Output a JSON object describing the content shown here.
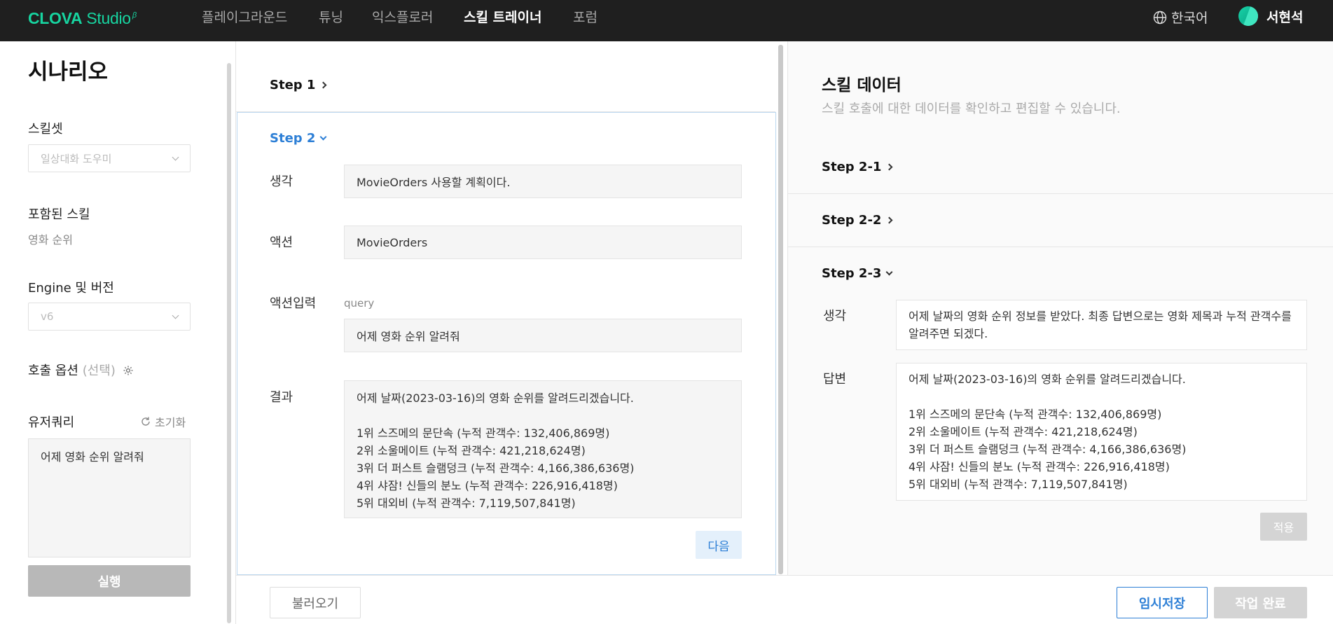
{
  "brand": {
    "name_bold": "CLOVA",
    "name_rest": " Studio",
    "beta": "β"
  },
  "nav": {
    "items": [
      "플레이그라운드",
      "튜닝",
      "익스플로러",
      "스킬 트레이너",
      "포럼"
    ],
    "language": "한국어",
    "user": "서현석"
  },
  "sidebar": {
    "title": "시나리오",
    "skillset_label": "스킬셋",
    "skillset_value": "일상대화 도우미",
    "included_label": "포함된 스킬",
    "included_value": "영화 순위",
    "engine_label": "Engine 및 버전",
    "engine_value": "v6",
    "call_option_label": "호출 옵션",
    "call_option_muted": "(선택)",
    "user_query_label": "유저쿼리",
    "reset_label": "초기화",
    "user_query_value": "어제 영화 순위 알려줘",
    "run_label": "실행"
  },
  "middle": {
    "step1": "Step 1",
    "step2": "Step 2",
    "thought_label": "생각",
    "thought_value": "MovieOrders 사용할 계획이다.",
    "action_label": "액션",
    "action_value": "MovieOrders",
    "action_input_label": "액션입력",
    "action_input_key": "query",
    "action_input_value": "어제 영화 순위 알려줘",
    "result_label": "결과",
    "result_value": "어제 날짜(2023-03-16)의 영화 순위를 알려드리겠습니다.\n\n1위 스즈메의 문단속 (누적 관객수: 132,406,869명)\n2위 소울메이트 (누적 관객수: 421,218,624명)\n3위 더 퍼스트 슬램덩크 (누적 관객수: 4,166,386,636명)\n4위 샤잠! 신들의 분노 (누적 관객수: 226,916,418명)\n5위 대외비 (누적 관객수: 7,119,507,841명)",
    "next_label": "다음"
  },
  "right": {
    "title": "스킬 데이터",
    "subtitle": "스킬 호출에 대한 데이터를 확인하고 편집할 수 있습니다.",
    "step2_1": "Step 2-1",
    "step2_2": "Step 2-2",
    "step2_3": "Step 2-3",
    "thought_label": "생각",
    "thought_value": "어제 날짜의 영화 순위 정보를 받았다. 최종 답변으로는 영화 제목과 누적 관객수를 알려주면 되겠다.",
    "answer_label": "답변",
    "answer_value": "어제 날짜(2023-03-16)의 영화 순위를 알려드리겠습니다.\n\n1위 스즈메의 문단속 (누적 관객수: 132,406,869명)\n2위 소울메이트 (누적 관객수: 421,218,624명)\n3위 더 퍼스트 슬램덩크 (누적 관객수: 4,166,386,636명)\n4위 샤잠! 신들의 분노 (누적 관객수: 226,916,418명)\n5위 대외비 (누적 관객수: 7,119,507,841명)",
    "apply_label": "적용"
  },
  "footer": {
    "load_label": "불러오기",
    "temp_save_label": "임시저장",
    "done_label": "작업 완료"
  },
  "colors": {
    "accent": "#2d7fd6",
    "brand": "#17d4a0",
    "nav_bg": "#1f1f1f"
  }
}
